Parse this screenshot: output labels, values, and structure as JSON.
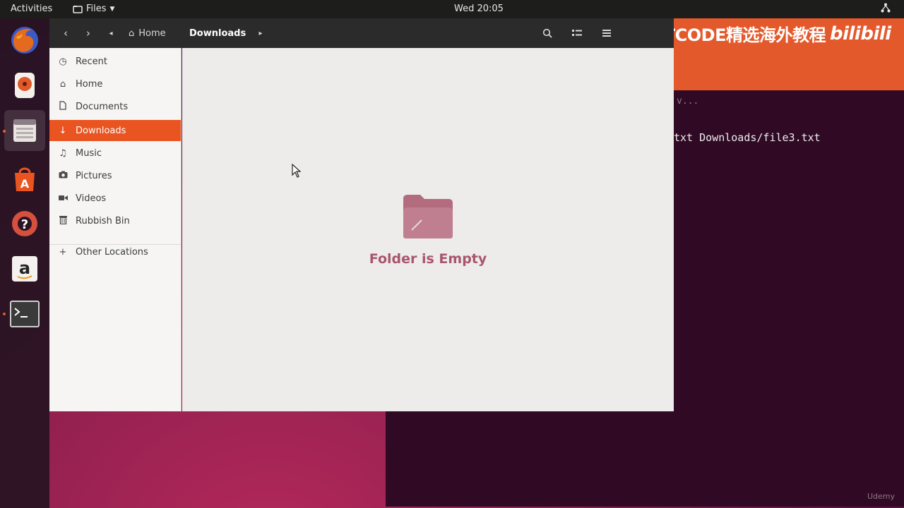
{
  "topbar": {
    "activities": "Activities",
    "app_menu": "Files",
    "clock": "Wed 20:05",
    "tray_icon": "network-icon"
  },
  "dock": {
    "items": [
      "firefox",
      "rhythmbox",
      "files",
      "ubuntu-software",
      "help",
      "amazon",
      "terminal"
    ]
  },
  "files": {
    "breadcrumb": {
      "home_label": "Home",
      "current_label": "Downloads"
    },
    "sidebar": {
      "items": [
        {
          "label": "Recent",
          "icon": "clock-icon"
        },
        {
          "label": "Home",
          "icon": "home-icon"
        },
        {
          "label": "Documents",
          "icon": "document-icon"
        },
        {
          "label": "Downloads",
          "icon": "download-icon",
          "selected": true
        },
        {
          "label": "Music",
          "icon": "music-icon"
        },
        {
          "label": "Pictures",
          "icon": "camera-icon"
        },
        {
          "label": "Videos",
          "icon": "video-icon"
        },
        {
          "label": "Rubbish Bin",
          "icon": "trash-icon"
        }
      ],
      "other_locations": "Other Locations"
    },
    "empty_state": "Folder is Empty"
  },
  "terminal": {
    "dim_text": "v...",
    "line": "txt Downloads/file3.txt"
  },
  "watermark": {
    "text": "POSTCODE精选海外教程",
    "brand": "bilibili"
  },
  "corner_mark": "Udemy",
  "colors": {
    "accent": "#e95420",
    "terminal_bg": "#300a24",
    "empty_text": "#a8566c"
  }
}
